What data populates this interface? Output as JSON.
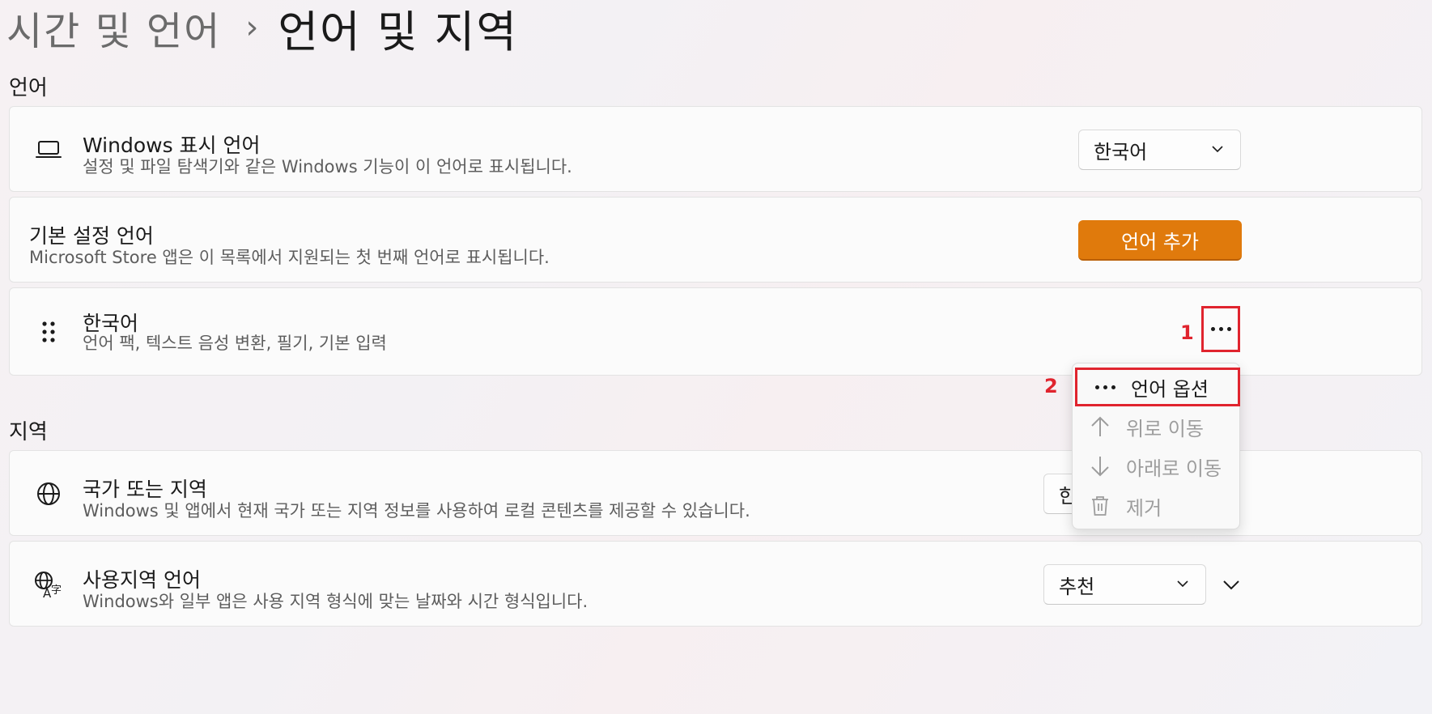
{
  "breadcrumb": {
    "parent": "시간 및 언어",
    "separator": "›",
    "current": "언어 및 지역"
  },
  "language_section": {
    "title": "언어",
    "display_language": {
      "icon": "laptop-icon",
      "title": "Windows 표시 언어",
      "subtitle": "설정 및 파일 탐색기와 같은 Windows 기능이 이 언어로 표시됩니다.",
      "selected": "한국어"
    },
    "preferred_languages": {
      "title": "기본 설정 언어",
      "subtitle": "Microsoft Store 앱은 이 목록에서 지원되는 첫 번째 언어로 표시됩니다.",
      "add_button": "언어 추가"
    },
    "language_item": {
      "icon": "drag-handle-icon",
      "title": "한국어",
      "subtitle": "언어 팩, 텍스트 음성 변환, 필기, 기본 입력",
      "more_icon": "more-icon"
    }
  },
  "region_section": {
    "title": "지역",
    "country": {
      "icon": "globe-icon",
      "title": "국가 또는 지역",
      "subtitle": "Windows 및 앱에서 현재 국가 또는 지역 정보를 사용하여 로컬 콘텐츠를 제공할 수 있습니다.",
      "selected": "한"
    },
    "regional_format": {
      "icon": "language-format-icon",
      "title": "사용지역 언어",
      "subtitle": "Windows와 일부 앱은 사용 지역 형식에 맞는 날짜와 시간 형식입니다.",
      "selected": "추천"
    }
  },
  "context_menu": {
    "items": [
      {
        "label": "언어 옵션",
        "icon": "more-icon",
        "enabled": true
      },
      {
        "label": "위로 이동",
        "icon": "arrow-up-icon",
        "enabled": false
      },
      {
        "label": "아래로 이동",
        "icon": "arrow-down-icon",
        "enabled": false
      },
      {
        "label": "제거",
        "icon": "trash-icon",
        "enabled": false
      }
    ]
  },
  "annotations": {
    "step1": "1",
    "step2": "2"
  },
  "colors": {
    "accent": "#e07a0c",
    "highlight": "#e0242e"
  }
}
